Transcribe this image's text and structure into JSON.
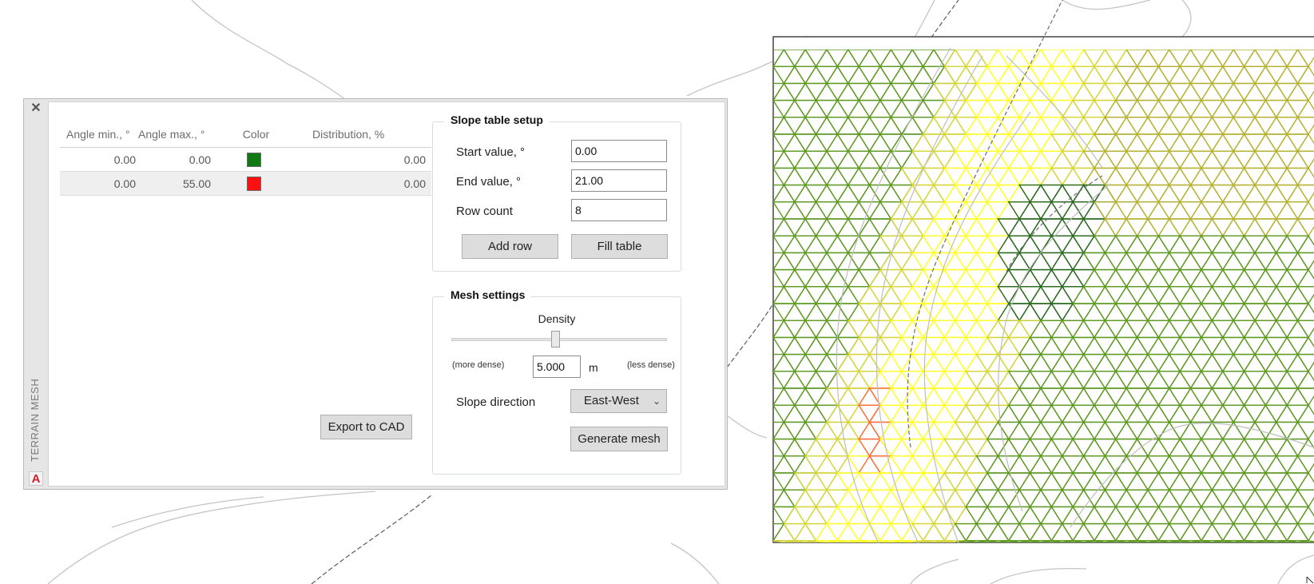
{
  "palette": {
    "title": "TERRAIN MESH",
    "close_glyph": "✕",
    "logo_letter": "A"
  },
  "table": {
    "headers": [
      "Angle min., °",
      "Angle max., °",
      "Color",
      "Distribution, %"
    ],
    "rows": [
      {
        "min": "0.00",
        "max": "0.00",
        "color": "#0f7a12",
        "dist": "0.00"
      },
      {
        "min": "0.00",
        "max": "55.00",
        "color": "#ff1010",
        "dist": "0.00"
      }
    ]
  },
  "export_label": "Export to CAD",
  "slope_setup": {
    "title": "Slope table setup",
    "start_label": "Start value, °",
    "start_value": "0.00",
    "end_label": "End value, °",
    "end_value": "21.00",
    "rows_label": "Row count",
    "rows_value": "8",
    "add_row_label": "Add row",
    "fill_table_label": "Fill table"
  },
  "mesh_settings": {
    "title": "Mesh settings",
    "density_label": "Density",
    "density_level": 0.48,
    "more_dense": "(more dense)",
    "less_dense": "(less dense)",
    "density_value": "5.000",
    "density_unit": "m",
    "direction_label": "Slope direction",
    "direction_value": "East-West",
    "generate_label": "Generate mesh"
  }
}
